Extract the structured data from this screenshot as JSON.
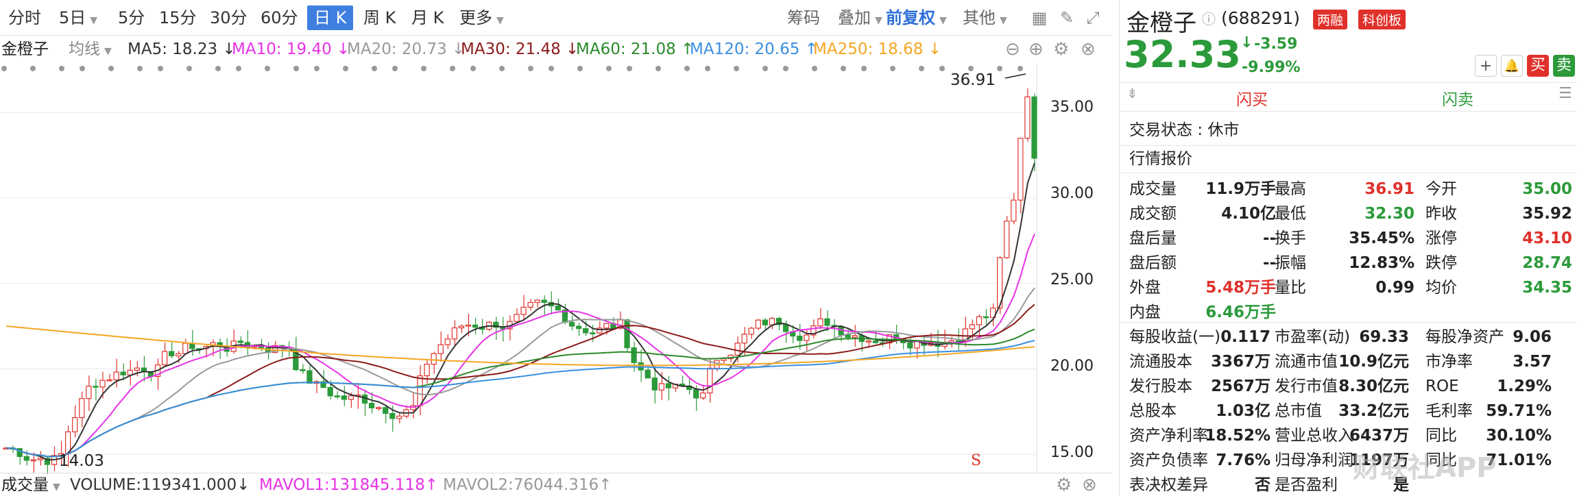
{
  "toolbar": {
    "periods": [
      "分时",
      "5日",
      "5分",
      "15分",
      "30分",
      "60分",
      "日 K",
      "周 K",
      "月 K",
      "更多"
    ],
    "active_period": "日 K",
    "chip": "筹码",
    "overlay": "叠加",
    "adjust": "前复权",
    "other": "其他"
  },
  "ma_bar": {
    "stock": "金橙子",
    "mode": "均线",
    "ma5": "MA5: 18.23 ↓",
    "ma10": "MA10: 19.40 ↓",
    "ma20": "MA20: 20.73 ↓",
    "ma30": "MA30: 21.48 ↓",
    "ma60": "MA60: 21.08 ↑",
    "ma120": "MA120: 20.65 ↑",
    "ma250": "MA250: 18.68 ↓",
    "colors": {
      "ma5": "#333333",
      "ma10": "#e632e6",
      "ma20": "#999999",
      "ma30": "#8b1a1a",
      "ma60": "#2b8a2b",
      "ma120": "#3a8fe0",
      "ma250": "#f5a623"
    }
  },
  "chart": {
    "high_label": "36.91",
    "low_label": "14.03",
    "signal": "S",
    "y_ticks": [
      "35.00",
      "30.00",
      "25.00",
      "20.00",
      "15.00"
    ]
  },
  "chart_data": {
    "type": "candlestick",
    "y_ticks": [
      35,
      30,
      25,
      20,
      15
    ],
    "ylim": [
      14,
      37.5
    ],
    "high": 36.91,
    "low": 14.03
  },
  "volume_bar": {
    "label": "成交量",
    "volume": "VOLUME:119341.000↓",
    "mavol1": "MAVOL1:131845.118↑",
    "mavol2": "MAVOL2:76044.316↑"
  },
  "quote": {
    "name": "金橙子",
    "code": "(688291)",
    "badge1": "两融",
    "badge2": "科创板",
    "price": "32.33",
    "change": "-3.59",
    "change_pct": "-9.99%",
    "sell_btn": "卖",
    "buy_btn": "买",
    "flash_buy": "闪买",
    "flash_sell": "闪卖",
    "trade_status": "交易状态 : 休市",
    "section_title": "行情报价"
  },
  "quote_grid": [
    [
      [
        "成交量",
        "11.9万手",
        ""
      ],
      [
        "最高",
        "36.91",
        "red"
      ],
      [
        "今开",
        "35.00",
        "green"
      ]
    ],
    [
      [
        "成交额",
        "4.10亿",
        ""
      ],
      [
        "最低",
        "32.30",
        "green"
      ],
      [
        "昨收",
        "35.92",
        ""
      ]
    ],
    [
      [
        "盘后量",
        "--",
        ""
      ],
      [
        "换手",
        "35.45%",
        ""
      ],
      [
        "涨停",
        "43.10",
        "red"
      ]
    ],
    [
      [
        "盘后额",
        "--",
        ""
      ],
      [
        "振幅",
        "12.83%",
        ""
      ],
      [
        "跌停",
        "28.74",
        "green"
      ]
    ],
    [
      [
        "外盘",
        "5.48万手",
        "red"
      ],
      [
        "量比",
        "0.99",
        ""
      ],
      [
        "均价",
        "34.35",
        "green"
      ]
    ],
    [
      [
        "内盘",
        "6.46万手",
        "green"
      ],
      [
        "",
        "",
        ""
      ],
      [
        "",
        "",
        ""
      ]
    ]
  ],
  "fundamentals": [
    [
      [
        "每股收益(一)",
        "0.117"
      ],
      [
        "市盈率(动)",
        "69.33"
      ],
      [
        "每股净资产",
        "9.06"
      ]
    ],
    [
      [
        "流通股本",
        "3367万"
      ],
      [
        "流通市值",
        "10.9亿元"
      ],
      [
        "市净率",
        "3.57"
      ]
    ],
    [
      [
        "发行股本",
        "2567万"
      ],
      [
        "发行市值",
        "8.30亿元"
      ],
      [
        "ROE",
        "1.29%"
      ]
    ],
    [
      [
        "总股本",
        "1.03亿"
      ],
      [
        "总市值",
        "33.2亿元"
      ],
      [
        "毛利率",
        "59.71%"
      ]
    ],
    [
      [
        "资产净利率",
        "18.52%"
      ],
      [
        "营业总收入",
        "6437万"
      ],
      [
        "同比",
        "30.10%"
      ]
    ],
    [
      [
        "资产负债率",
        "7.76%"
      ],
      [
        "归母净利润",
        "1197万"
      ],
      [
        "同比",
        "71.01%"
      ]
    ],
    [
      [
        "表决权差异",
        "否"
      ],
      [
        "是否盈利",
        "是"
      ],
      [
        "",
        ""
      ]
    ]
  ],
  "watermark": "财联社APP"
}
